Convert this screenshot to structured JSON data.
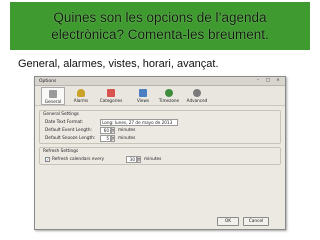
{
  "slide": {
    "title_line1": "Quines son les opcions de l’agenda",
    "title_line2": "electrònica? Comenta-les breument.",
    "bullet": "General, alarmes, vistes, horari, avançat."
  },
  "dialog": {
    "title": "Options",
    "window_controls": {
      "minimize": "–",
      "maximize": "□",
      "close": "×"
    },
    "tabs": [
      {
        "label": "General",
        "icon": "general-icon",
        "color": "#9a9a9a",
        "active": true
      },
      {
        "label": "Alarms",
        "icon": "alarm-icon",
        "color": "#c9a227",
        "active": false
      },
      {
        "label": "Categories",
        "icon": "categories-icon",
        "color": "#d9534f",
        "active": false
      },
      {
        "label": "Views",
        "icon": "views-icon",
        "color": "#4a7fc1",
        "active": false
      },
      {
        "label": "Timezone",
        "icon": "timezone-icon",
        "color": "#3e8e3e",
        "active": false
      },
      {
        "label": "Advanced",
        "icon": "advanced-icon",
        "color": "#7a7a7a",
        "active": false
      }
    ],
    "general_settings": {
      "legend": "General Settings",
      "date_format_label": "Date Text Format:",
      "date_format_value": "Long: lunes, 27 de mayo de 2013",
      "event_length_label": "Default Event Length:",
      "event_length_value": "60",
      "event_length_unit": "minutes",
      "snooze_label": "Default Snooze Length:",
      "snooze_value": "5",
      "snooze_unit": "minutes"
    },
    "refresh_settings": {
      "legend": "Refresh Settings",
      "refresh_label": "Refresh calendars every",
      "refresh_checked": true,
      "refresh_value": "30",
      "refresh_unit": "minutes"
    },
    "buttons": {
      "ok": "OK",
      "cancel": "Cancel"
    }
  }
}
